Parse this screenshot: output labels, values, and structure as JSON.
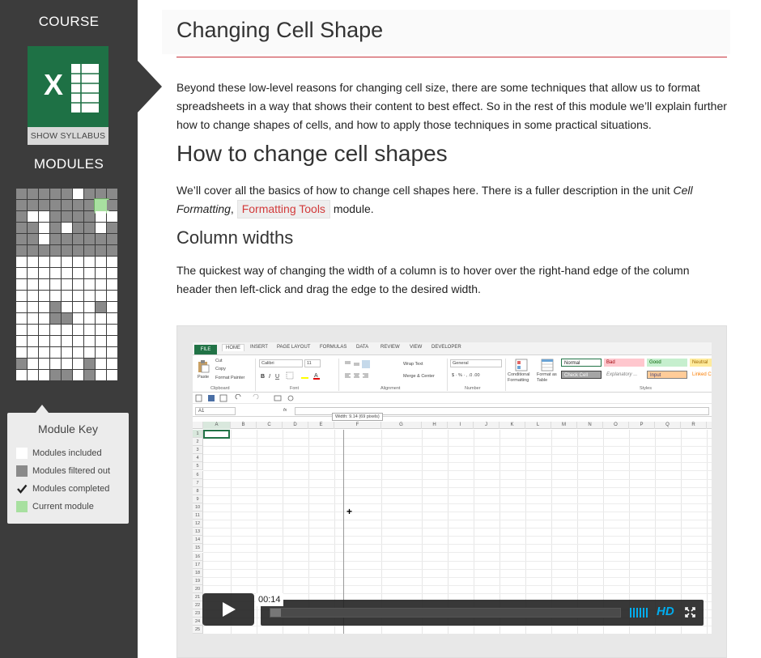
{
  "sidebar": {
    "course_heading": "COURSE",
    "show_syllabus": "SHOW SYLLABUS",
    "modules_heading": "MODULES",
    "logo_letter": "X",
    "logo_color": "#1e7145",
    "module_grid": {
      "columns": 9,
      "rows": 17,
      "cells": [
        "gggggwggg",
        "gggggggCg",
        "gwwggggww",
        "ggwgwggwg",
        "ggwgggggg",
        "ggggggggg",
        "wwwwwwwww",
        "wwwwwwwww",
        "wwwwwwwww",
        "wwwwwwwww",
        "wwwgwwwgw",
        "wwwggwwww",
        "wwwwwwwww",
        "wwwwwwwww",
        "wwwwwwwww",
        "gwwwwwgww",
        "wwwggwgww"
      ]
    },
    "module_key": {
      "title": "Module Key",
      "items": [
        {
          "label": "Modules included",
          "swatch": "#ffffff"
        },
        {
          "label": "Modules filtered out",
          "swatch": "#8a8a8a"
        },
        {
          "label": "Modules completed",
          "swatch": "check"
        },
        {
          "label": "Current module",
          "swatch": "#a8e0a0"
        }
      ]
    }
  },
  "main": {
    "title": "Changing Cell Shape",
    "intro": "Beyond these low-level reasons for changing cell size, there are some techniques that allow us to format spreadsheets in a way that shows their content to best effect. So in the rest of this module we’ll explain further how to change shapes of cells, and how to apply those techniques in some practical situations.",
    "h2": "How to change cell shapes",
    "cover_text_1": "We’ll cover all the basics of how to change cell shapes here. There is a fuller description in  the unit ",
    "cover_italic": "Cell Formatting",
    "cover_comma": ", ",
    "cover_link": "Formatting Tools",
    "cover_text_2": " module.",
    "h3": "Column widths",
    "col_text": "The quickest way of changing the width of a column is to hover over the right-hand edge of the column header then left-click and drag the edge to the desired width."
  },
  "video": {
    "current_time": "00:14",
    "progress_fraction": 0.03,
    "hd_label": "HD",
    "excel": {
      "tabs": [
        "FILE",
        "HOME",
        "INSERT",
        "PAGE LAYOUT",
        "FORMULAS",
        "DATA",
        "REVIEW",
        "VIEW",
        "DEVELOPER"
      ],
      "clipboard": {
        "cut": "Cut",
        "copy": "Copy",
        "paste": "Paste",
        "format_painter": "Format Painter",
        "group": "Clipboard"
      },
      "font": {
        "name": "Calibri",
        "size": "11",
        "group": "Font"
      },
      "alignment": {
        "wrap": "Wrap Text",
        "merge": "Merge & Center",
        "group": "Alignment"
      },
      "number": {
        "format": "General",
        "group": "Number"
      },
      "styles_buttons": {
        "conditional": "Conditional Formatting",
        "format_table": "Format as Table"
      },
      "styles": [
        {
          "label": "Normal",
          "bg": "#ffffff",
          "fg": "#000000"
        },
        {
          "label": "Bad",
          "bg": "#ffc7ce",
          "fg": "#9c0006"
        },
        {
          "label": "Good",
          "bg": "#c6efce",
          "fg": "#006100"
        },
        {
          "label": "Neutral",
          "bg": "#ffeb9c",
          "fg": "#9c6500"
        },
        {
          "label": "Check Cell",
          "bg": "#a5a5a5",
          "fg": "#ffffff"
        },
        {
          "label": "Explanatory ...",
          "bg": "#ffffff",
          "fg": "#7f7f7f"
        },
        {
          "label": "Input",
          "bg": "#ffcc99",
          "fg": "#3f3f76"
        },
        {
          "label": "Linked C",
          "bg": "#ffffff",
          "fg": "#fa7d00"
        }
      ],
      "styles_group": "Styles",
      "name_box": "A1",
      "formula_fx": "fx",
      "tooltip": "Width: 9.14 (69 pixels)",
      "columns": [
        "A",
        "B",
        "C",
        "D",
        "E",
        "F",
        "G",
        "H",
        "I",
        "J",
        "K",
        "L",
        "M",
        "N",
        "O",
        "P",
        "Q",
        "R"
      ],
      "rows": [
        "1",
        "2",
        "3",
        "4",
        "5",
        "6",
        "7",
        "8",
        "9",
        "10",
        "11",
        "12",
        "13",
        "14",
        "15",
        "16",
        "17",
        "18",
        "19",
        "20",
        "21",
        "22",
        "23",
        "24",
        "25"
      ]
    }
  }
}
